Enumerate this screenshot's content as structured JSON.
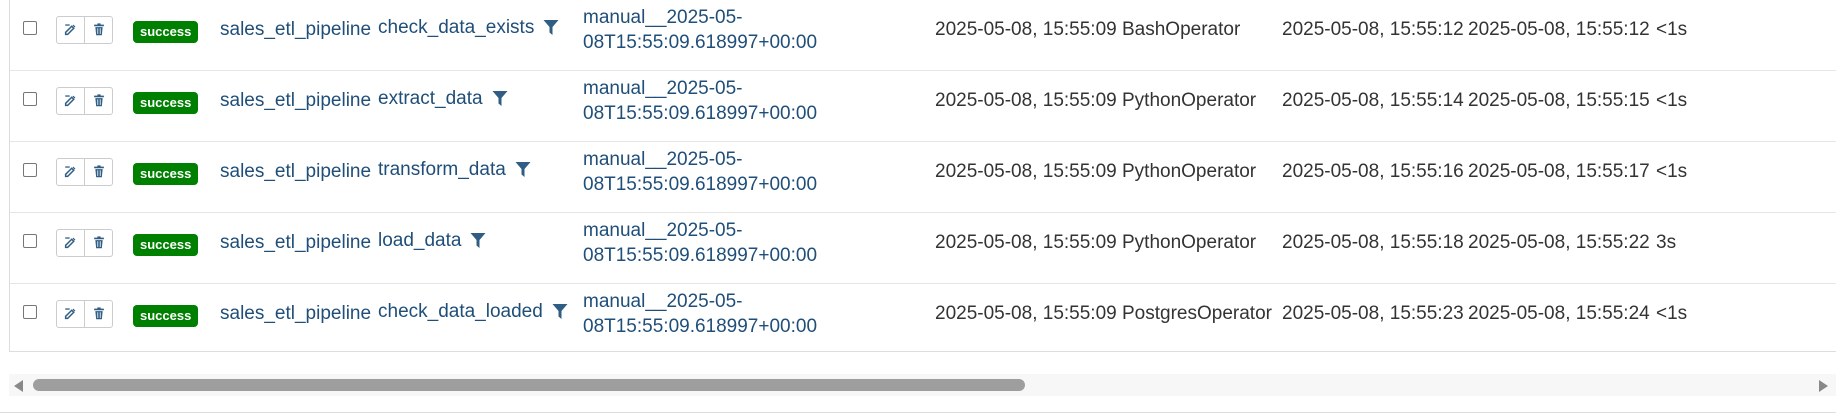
{
  "rows": [
    {
      "state": "success",
      "dag_id": "sales_etl_pipeline",
      "task_id": "check_data_exists",
      "run_id": "manual__2025-05-08T15:55:09.618997+00:00",
      "execution_date": "2025-05-08, 15:55:09",
      "operator": "BashOperator",
      "start_date": "2025-05-08, 15:55:12",
      "end_date": "2025-05-08, 15:55:12",
      "duration": "<1s"
    },
    {
      "state": "success",
      "dag_id": "sales_etl_pipeline",
      "task_id": "extract_data",
      "run_id": "manual__2025-05-08T15:55:09.618997+00:00",
      "execution_date": "2025-05-08, 15:55:09",
      "operator": "PythonOperator",
      "start_date": "2025-05-08, 15:55:14",
      "end_date": "2025-05-08, 15:55:15",
      "duration": "<1s"
    },
    {
      "state": "success",
      "dag_id": "sales_etl_pipeline",
      "task_id": "transform_data",
      "run_id": "manual__2025-05-08T15:55:09.618997+00:00",
      "execution_date": "2025-05-08, 15:55:09",
      "operator": "PythonOperator",
      "start_date": "2025-05-08, 15:55:16",
      "end_date": "2025-05-08, 15:55:17",
      "duration": "<1s"
    },
    {
      "state": "success",
      "dag_id": "sales_etl_pipeline",
      "task_id": "load_data",
      "run_id": "manual__2025-05-08T15:55:09.618997+00:00",
      "execution_date": "2025-05-08, 15:55:09",
      "operator": "PythonOperator",
      "start_date": "2025-05-08, 15:55:18",
      "end_date": "2025-05-08, 15:55:22",
      "duration": "3s"
    },
    {
      "state": "success",
      "dag_id": "sales_etl_pipeline",
      "task_id": "check_data_loaded",
      "run_id": "manual__2025-05-08T15:55:09.618997+00:00",
      "execution_date": "2025-05-08, 15:55:09",
      "operator": "PostgresOperator",
      "start_date": "2025-05-08, 15:55:23",
      "end_date": "2025-05-08, 15:55:24",
      "duration": "<1s"
    }
  ],
  "icons": {
    "edit": "edit-icon",
    "delete": "trash-icon",
    "filter": "filter-icon"
  },
  "colors": {
    "success": "#008000",
    "link": "#1f4e79",
    "icon": "#2f5d83"
  },
  "scroll": {
    "horizontal_position": 0
  }
}
